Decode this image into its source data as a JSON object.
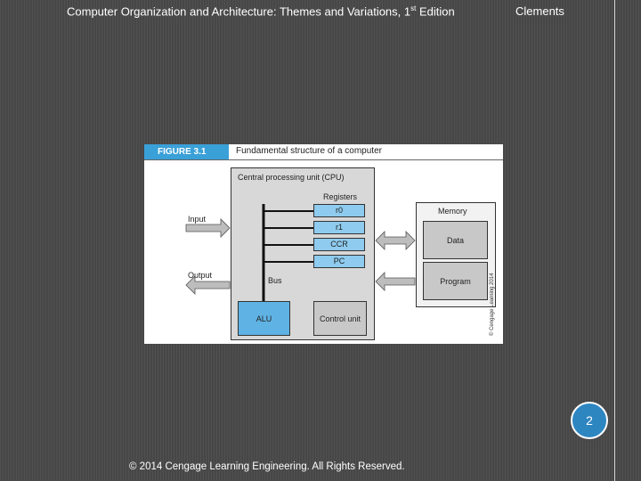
{
  "header": {
    "title_main": "Computer Organization and Architecture: Themes and Variations, 1",
    "title_sup": "st",
    "title_end": " Edition",
    "author": "Clements"
  },
  "figure": {
    "label": "FIGURE 3.1",
    "caption": "Fundamental structure of a computer",
    "cpu_label": "Central processing unit (CPU)",
    "registers_label": "Registers",
    "registers": [
      "r0",
      "r1",
      "CCR",
      "PC"
    ],
    "bus_label": "Bus",
    "alu_label": "ALU",
    "control_label": "Control unit",
    "input_label": "Input",
    "output_label": "Output",
    "memory_label": "Memory",
    "data_label": "Data",
    "program_label": "Program",
    "copyright": "© Cengage Learning 2014",
    "colors": {
      "accent_blue": "#3aa0d8",
      "register_blue": "#8ecbee",
      "alu_blue": "#5fb3e4",
      "grey_unit": "#c8c8c8"
    }
  },
  "page_number": "2",
  "footer": "© 2014 Cengage Learning Engineering. All Rights Reserved."
}
